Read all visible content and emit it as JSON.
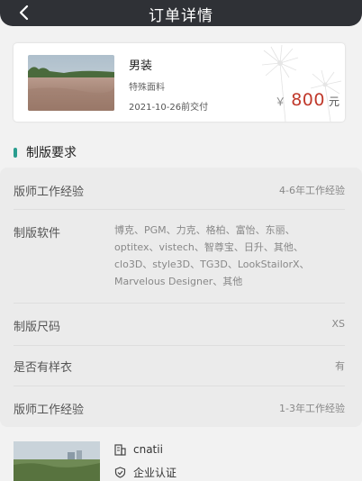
{
  "header": {
    "title": "订单详情",
    "back_icon": "chevron-left-icon"
  },
  "order": {
    "title": "男装",
    "material": "特殊面料",
    "delivery": "2021-10-26前交付",
    "price_symbol": "￥",
    "price": "800",
    "price_unit": "元"
  },
  "section": {
    "title": "制版要求",
    "accent": "#2a9d8f"
  },
  "requirements": [
    {
      "label": "版师工作经验",
      "value": "4-6年工作经验"
    },
    {
      "label": "制版软件",
      "lines": [
        "博克、PGM、力克、格柏、富怡、东丽、",
        "optitex、vistech、智尊宝、日升、其他、",
        "clo3D、style3D、TG3D、LookStailorX、",
        "Marvelous Designer、其他"
      ]
    },
    {
      "label": "制版尺码",
      "value": "XS"
    },
    {
      "label": "是否有样衣",
      "value": "有"
    },
    {
      "label": "版师工作经验",
      "value": "1-3年工作经验"
    }
  ],
  "company": {
    "name": "cnatii",
    "verify": "企业认证"
  },
  "colors": {
    "navbar": "#2f3136",
    "price": "#c0392b",
    "background": "#f2f2f2"
  }
}
